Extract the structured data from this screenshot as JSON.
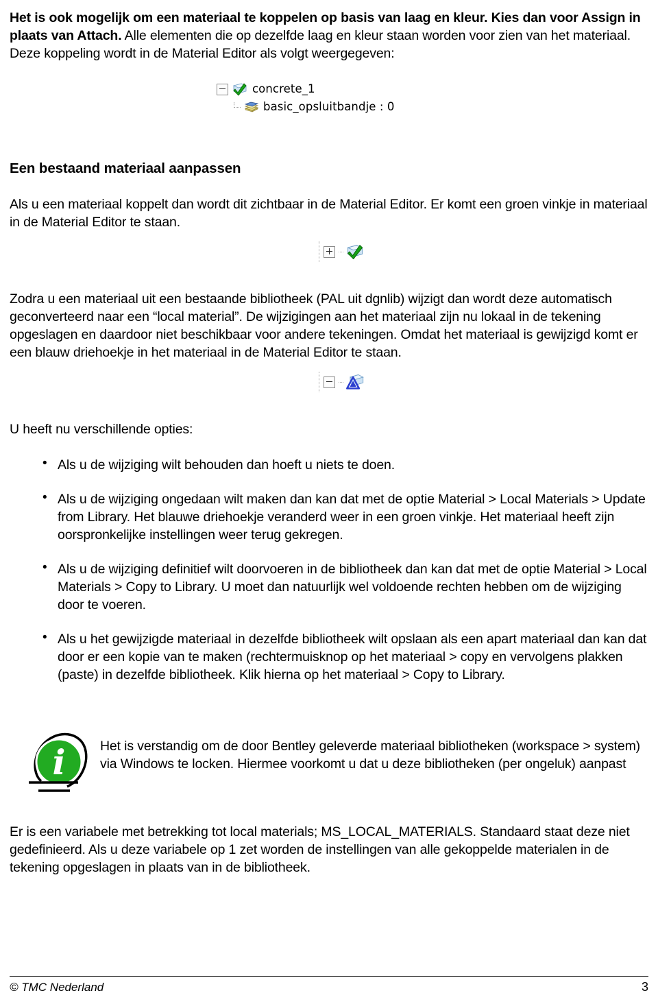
{
  "document": {
    "intro_paragraph": "Het is ook mogelijk om een materiaal te koppelen op basis van laag en kleur. Kies dan voor Assign in plaats van Attach. Alle elementen die op dezelfde laag en kleur staan worden voor zien van het materiaal. Deze koppeling wordt in de Material Editor als volgt weergegeven:",
    "intro_bold_lead": "Het is ook mogelijk om een materiaal te koppelen op basis van laag en kleur. Kies dan voor Assign in plaats van Attach.",
    "intro_rest": " Alle elementen die op dezelfde laag en kleur staan worden voor zien van het materiaal. Deze koppeling wordt in de Material Editor als volgt weergegeven:",
    "heading_1": "Een bestaand materiaal aanpassen",
    "paragraph_2": "Als u een materiaal koppelt dan wordt dit zichtbaar in de Material Editor. Er komt een groen vinkje in materiaal in de Material Editor te staan.",
    "paragraph_3": "Zodra u een materiaal uit een bestaande bibliotheek (PAL uit dgnlib) wijzigt dan wordt deze automatisch geconverteerd naar een “local material”. De wijzigingen aan het materiaal zijn nu lokaal in de tekening opgeslagen en daardoor niet beschikbaar voor andere tekeningen. Omdat het materiaal is gewijzigd komt er een blauw driehoekje in het materiaal in de Material Editor te staan.",
    "options_intro": "U heeft nu verschillende opties:",
    "options": [
      "Als u de wijziging wilt behouden dan hoeft u niets te doen.",
      "Als u de wijziging ongedaan wilt maken dan kan dat met de optie Material > Local Materials > Update from Library. Het blauwe driehoekje veranderd weer in een groen vinkje. Het materiaal heeft zijn oorspronkelijke instellingen weer terug gekregen.",
      "Als u de wijziging definitief wilt doorvoeren in de bibliotheek dan kan dat met de optie Material > Local Materials > Copy to Library. U moet dan natuurlijk wel voldoende rechten hebben om de wijziging door te voeren.",
      "Als u het gewijzigde materiaal in dezelfde bibliotheek wilt opslaan als een apart materiaal dan kan dat door er een kopie van te maken (rechtermuisknop op het materiaal > copy en vervolgens plakken (paste) in dezelfde bibliotheek. Klik hierna op het materiaal > Copy to Library."
    ],
    "note_text": "Het is verstandig om de door Bentley geleverde materiaal bibliotheken (workspace > system) via Windows te locken. Hiermee voorkomt u dat u deze bibliotheken (per ongeluk) aanpast",
    "closing_paragraph": "Er is een variabele met betrekking tot local materials; MS_LOCAL_MATERIALS. Standaard staat deze niet gedefinieerd. Als u deze variabele op 1 zet worden de instellingen van alle gekoppelde materialen in de tekening opgeslagen in plaats van in de bibliotheek."
  },
  "tree_figure": {
    "parent": {
      "label": "concrete_1",
      "expander": "minus",
      "icon": "material-green-check-icon"
    },
    "child": {
      "label": "basic_opsluitbandje : 0",
      "icon": "books-stack-icon"
    }
  },
  "icon_figure_green": {
    "expander": "plus",
    "icon": "material-green-check-icon"
  },
  "icon_figure_blue": {
    "expander": "minus",
    "icon": "material-blue-triangle-icon"
  },
  "note": {
    "icon": "info-i-icon"
  },
  "footer": {
    "copyright": "© TMC Nederland",
    "page_number": "3"
  },
  "colors": {
    "green_check": "#17a318",
    "green_info": "#22ab22",
    "blue_triangle": "#2b3fd0",
    "icon_sheet": "#cfe4f5",
    "book_pages": "#e8dc86",
    "book_cover": "#5f8fd6",
    "text": "#000000",
    "background": "#ffffff"
  }
}
